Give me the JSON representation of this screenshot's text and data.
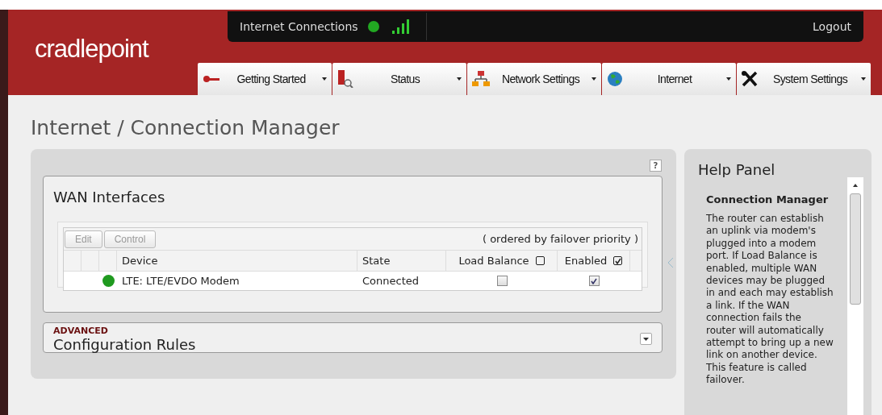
{
  "header": {
    "logo": "cradlepoint",
    "status_label": "Internet Connections",
    "logout": "Logout"
  },
  "nav_tabs": [
    {
      "label": "Getting Started"
    },
    {
      "label": "Status"
    },
    {
      "label": "Network Settings"
    },
    {
      "label": "Internet"
    },
    {
      "label": "System Settings"
    }
  ],
  "page_title": "Internet / Connection Manager",
  "help_button": "?",
  "wan_interfaces": {
    "title": "WAN Interfaces",
    "buttons": [
      {
        "label": "Edit",
        "disabled": true
      },
      {
        "label": "Control",
        "disabled": true
      }
    ],
    "order_note": "( ordered by failover priority )",
    "columns": [
      {
        "label": "Device"
      },
      {
        "label": "State"
      },
      {
        "label": "Load Balance",
        "checked": false
      },
      {
        "label": "Enabled",
        "checked": true
      }
    ],
    "rows": [
      {
        "color": "#1f9a1f",
        "device": "LTE: LTE/EVDO Modem",
        "state": "Connected",
        "load_balance": false,
        "enabled": true
      }
    ]
  },
  "configuration_rules": {
    "kicker": "ADVANCED",
    "title": "Configuration Rules",
    "expanded": false
  },
  "help_panel": {
    "title": "Help Panel",
    "heading": "Connection Manager",
    "text": "The router can establish an uplink via modem's plugged into a modem port. If Load Balance is enabled, multiple WAN devices may be plugged in and each may establish a link. If the WAN connection fails the router will automatically attempt to bring up a new link on another device. This feature is called failover."
  }
}
